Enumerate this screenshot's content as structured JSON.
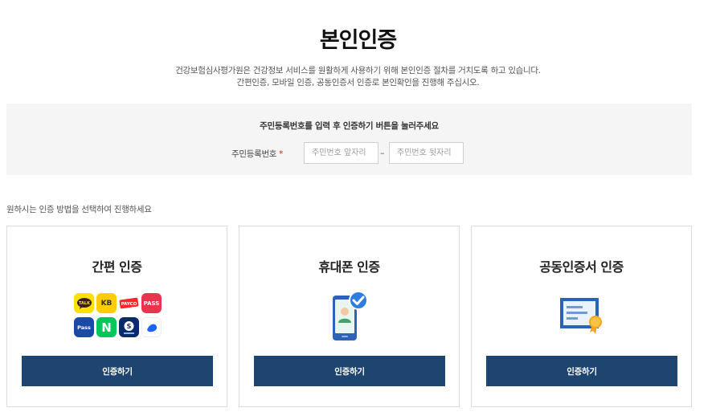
{
  "page": {
    "title": "본인인증",
    "desc_line1": "건강보험심사평가원은 건강정보 서비스를 원활하게 사용하기 위해 본인인증 절차를 거치도록 하고 있습니다.",
    "desc_line2": "간편인증, 모바일 인증, 공동인증서 인증로 본인확인을 진행해 주십시오."
  },
  "rrn_panel": {
    "instruction": "주민등록번호를 입력 후 인증하기 버튼을 눌러주세요",
    "label": "주민등록번호",
    "required_mark": "*",
    "front_placeholder": "주민번호 앞자리",
    "back_placeholder": "주민번호 뒷자리",
    "front_value": "",
    "back_value": "",
    "separator": "–"
  },
  "method_guide": "원하시는 인증 방법을 선택하여 진행하세요",
  "methods": [
    {
      "title": "간편 인증",
      "button": "인증하기",
      "icon": "simple-auth-apps-icon",
      "apps": [
        {
          "name": "kakao-talk-icon",
          "text": "TALK"
        },
        {
          "name": "kb-icon",
          "text": "KB"
        },
        {
          "name": "payco-icon",
          "text": "PAYCO"
        },
        {
          "name": "pass-icon",
          "text": "PASS"
        },
        {
          "name": "samsung-pass-icon",
          "text": "Pass"
        },
        {
          "name": "naver-icon",
          "text": "N"
        },
        {
          "name": "shinhan-icon",
          "text": "S"
        },
        {
          "name": "toss-icon",
          "text": ""
        }
      ]
    },
    {
      "title": "휴대폰 인증",
      "button": "인증하기",
      "icon": "mobile-verified-icon"
    },
    {
      "title": "공동인증서 인증",
      "button": "인증하기",
      "icon": "certificate-icon"
    }
  ],
  "colors": {
    "button_bg": "#1e4470",
    "panel_bg": "#f5f5f5",
    "required": "#e02020",
    "check_badge": "#2f7de1"
  }
}
